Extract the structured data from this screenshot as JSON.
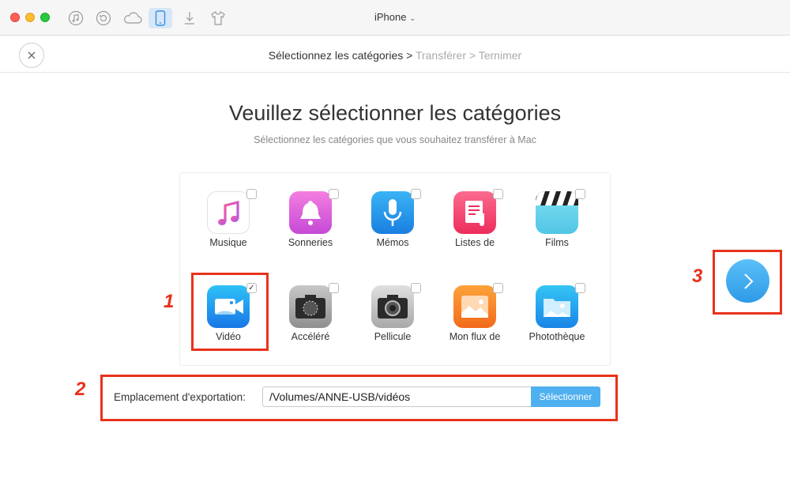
{
  "window": {
    "device_title": "iPhone",
    "toolbar_icons": [
      "music-icon",
      "restore-icon",
      "cloud-icon",
      "iphone-icon",
      "download-icon",
      "tshirt-icon"
    ]
  },
  "breadcrumb": {
    "step1": "Sélectionnez les catégories",
    "sep1": ">",
    "step2": "Transférer",
    "sep2": ">",
    "step3": "Ternimer"
  },
  "main": {
    "title": "Veuillez sélectionner les catégories",
    "subtitle": "Sélectionnez les catégories que vous souhaitez transférer à Mac"
  },
  "categories": [
    {
      "label": "Musique",
      "icon": "music-icon",
      "checked": false
    },
    {
      "label": "Sonneries",
      "icon": "bell-icon",
      "checked": false
    },
    {
      "label": "Mémos",
      "icon": "microphone-icon",
      "checked": false
    },
    {
      "label": "Listes de",
      "icon": "playlist-icon",
      "checked": false
    },
    {
      "label": "Films",
      "icon": "clapperboard-icon",
      "checked": false
    },
    {
      "label": "Vidéo",
      "icon": "video-camera-icon",
      "checked": true,
      "check_mark": "✓"
    },
    {
      "label": "Accéléré",
      "icon": "timelapse-camera-icon",
      "checked": false
    },
    {
      "label": "Pellicule",
      "icon": "camera-icon",
      "checked": false
    },
    {
      "label": "Mon flux de",
      "icon": "photo-stream-icon",
      "checked": false
    },
    {
      "label": "Photothèque",
      "icon": "photo-library-icon",
      "checked": false
    }
  ],
  "export": {
    "label": "Emplacement d'exportation:",
    "path": "/Volumes/ANNE-USB/vidéos",
    "button": "Sélectionner"
  },
  "annotations": {
    "n1": "1",
    "n2": "2",
    "n3": "3"
  },
  "colors": {
    "accent": "#4fb0ef",
    "annotation_red": "#e8321a"
  }
}
